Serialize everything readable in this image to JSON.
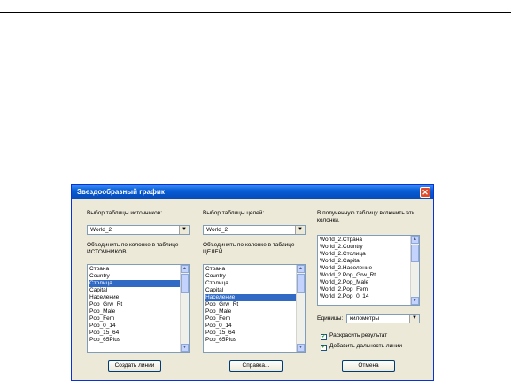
{
  "dialog": {
    "title": "Звездообразный график",
    "source_table": {
      "label": "Выбор таблицы источников:",
      "value": "World_2",
      "join_label": "Объединить по колонке в таблице ИСТОЧНИКОВ.",
      "columns": [
        "Страна",
        "Country",
        "Столица",
        "Capital",
        "Население",
        "Pop_Grw_Rt",
        "Pop_Male",
        "Pop_Fem",
        "Pop_0_14",
        "Pop_15_64",
        "Pop_65Plus"
      ],
      "selected": "Столица"
    },
    "target_table": {
      "label": "Выбор таблицы целей:",
      "value": "World_2",
      "join_label": "Объединить по колонке в таблице ЦЕЛЕЙ",
      "columns": [
        "Страна",
        "Country",
        "Столица",
        "Capital",
        "Население",
        "Pop_Grw_Rt",
        "Pop_Male",
        "Pop_Fem",
        "Pop_0_14",
        "Pop_15_64",
        "Pop_65Plus"
      ],
      "selected": "Население"
    },
    "include": {
      "label": "В полученную таблицу включить эти колонки.",
      "columns": [
        "World_2.Страна",
        "World_2.Country",
        "World_2.Столица",
        "World_2.Capital",
        "World_2.Население",
        "World_2.Pop_Grw_Rt",
        "World_2.Pop_Male",
        "World_2.Pop_Fem",
        "World_2.Pop_0_14"
      ]
    },
    "units": {
      "label": "Единицы:",
      "value": "километры"
    },
    "options": {
      "colorize": "Раскрасить результат",
      "add_distance": "Добавить дальность линии"
    },
    "buttons": {
      "create": "Создать линии",
      "help": "Справка...",
      "cancel": "Отмена"
    }
  }
}
